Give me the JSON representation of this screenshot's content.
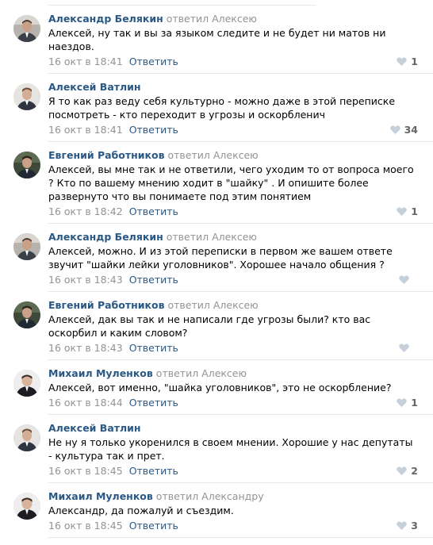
{
  "colors": {
    "author": "#2a5885",
    "muted": "#939393",
    "heart": "#c5d0db",
    "separator": "#e7e8ec"
  },
  "comments": [
    {
      "author": "Александр Белякин",
      "replied": "ответил Алексею",
      "text": "Алексей, ну так и вы за языком следите и не будет ни матов ни наездов.",
      "date": "16 окт в 18:41",
      "reply_label": "Ответить",
      "likes": "1",
      "avatar_icon": "person-photo"
    },
    {
      "author": "Алексей Ватлин",
      "replied": "",
      "text": "Я то как раз веду себя культурно - можно даже в этой переписке посмотреть - кто переходит в угрозы и оскорбленич",
      "date": "16 окт в 18:41",
      "reply_label": "Ответить",
      "likes": "34",
      "avatar_icon": "person-photo"
    },
    {
      "author": "Евгений Работников",
      "replied": "ответил Алексею",
      "text": "Алексей, вы мне так и не ответили, чего уходим то от вопроса моего ? Кто по вашему мнению ходит в \"шайку\" . И опишите более развернуто что вы понимаете под этим понятием",
      "date": "16 окт в 18:42",
      "reply_label": "Ответить",
      "likes": "1",
      "avatar_icon": "person-photo"
    },
    {
      "author": "Александр Белякин",
      "replied": "ответил Алексею",
      "text": "Алексей, можно. И из этой переписки в первом же вашем ответе звучит \"шайки лейки уголовников\". Хорошее начало общения ?",
      "date": "16 окт в 18:43",
      "reply_label": "Ответить",
      "likes": "",
      "avatar_icon": "person-photo"
    },
    {
      "author": "Евгений Работников",
      "replied": "ответил Алексею",
      "text": "Алексей, дак вы так и не написали где угрозы были? кто вас оскорбил и каким словом?",
      "date": "16 окт в 18:43",
      "reply_label": "Ответить",
      "likes": "",
      "avatar_icon": "person-photo"
    },
    {
      "author": "Михаил Муленков",
      "replied": "ответил Алексею",
      "text": "Алексей, вот именно, \"шайка уголовников\", это не оскорбление?",
      "date": "16 окт в 18:44",
      "reply_label": "Ответить",
      "likes": "1",
      "avatar_icon": "person-photo"
    },
    {
      "author": "Алексей Ватлин",
      "replied": "",
      "text": "Не ну я только укоренился в своем мнении. Хорошие у нас депутаты - культура так и прет.",
      "date": "16 окт в 18:45",
      "reply_label": "Ответить",
      "likes": "2",
      "avatar_icon": "person-photo"
    },
    {
      "author": "Михаил Муленков",
      "replied": "ответил Александру",
      "text": "Александр, да пожалуй и съездим.",
      "date": "16 окт в 18:45",
      "reply_label": "Ответить",
      "likes": "3",
      "avatar_icon": "person-photo"
    }
  ]
}
